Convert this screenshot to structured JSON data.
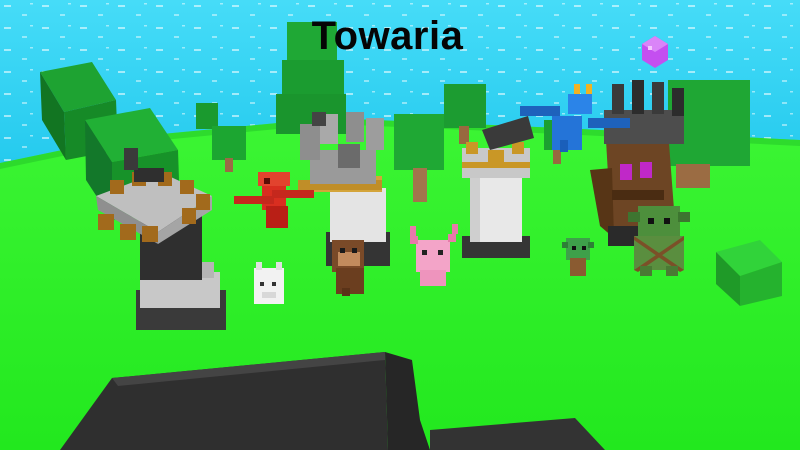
{
  "game": {
    "title": "Towaria"
  },
  "colors": {
    "water": "#2fd3f2",
    "grass": "#2ef02a",
    "tree_leaf": "#1db02e",
    "tree_trunk": "#a0724a",
    "pit": "#3a3a3a",
    "stone": "#808080",
    "tower_white": "#ececec",
    "crystal": "#c050f0"
  },
  "scene_objects": [
    "bomb-tower",
    "castle-tower",
    "cannon-tower",
    "tiki-tower",
    "red-dragon",
    "blue-dragon",
    "monkey",
    "pink-axolotl",
    "white-cat",
    "small-goblin",
    "large-goblin",
    "purple-crystal",
    "pit"
  ]
}
